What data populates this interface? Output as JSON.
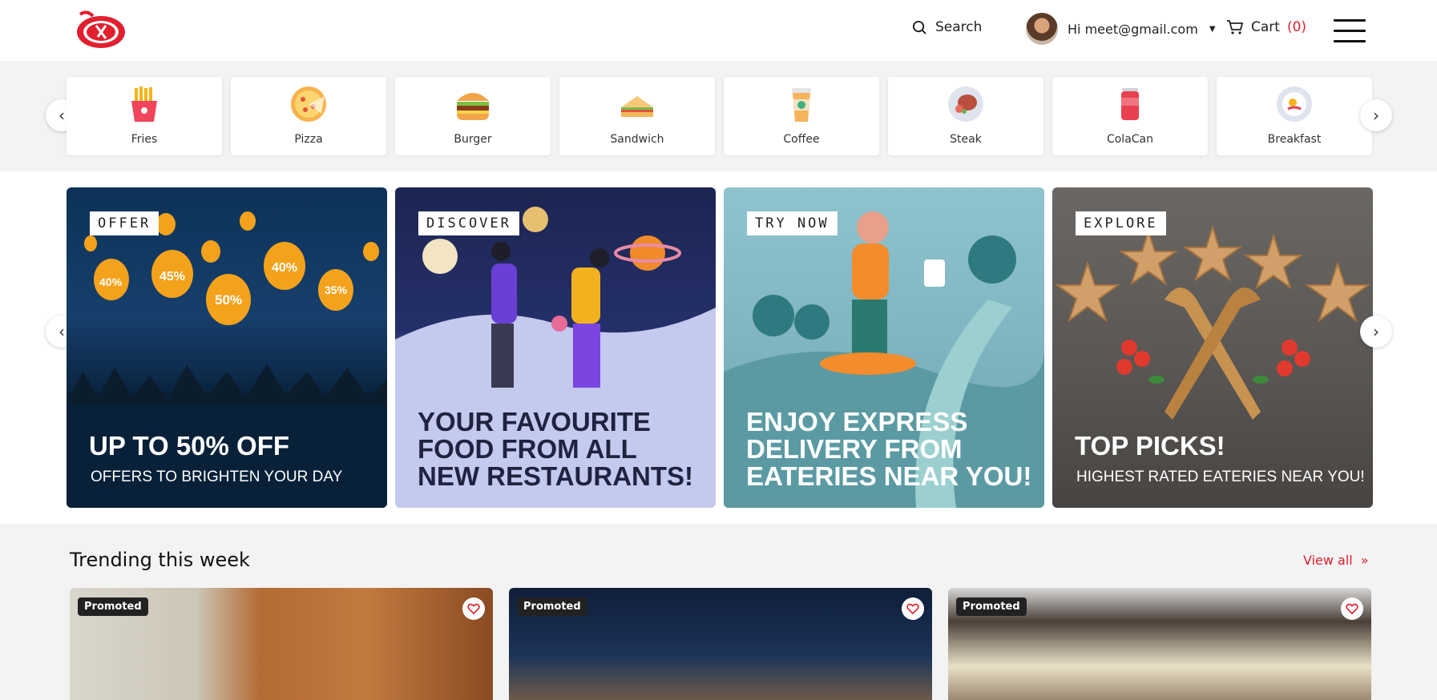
{
  "header": {
    "search_label": "Search",
    "user_greeting": "Hi meet@gmail.com",
    "cart_label": "Cart",
    "cart_count": "(0)"
  },
  "categories": [
    {
      "label": "Fries",
      "icon": "fries-icon"
    },
    {
      "label": "Pizza",
      "icon": "pizza-icon"
    },
    {
      "label": "Burger",
      "icon": "burger-icon"
    },
    {
      "label": "Sandwich",
      "icon": "sandwich-icon"
    },
    {
      "label": "Coffee",
      "icon": "coffee-icon"
    },
    {
      "label": "Steak",
      "icon": "steak-icon"
    },
    {
      "label": "ColaCan",
      "icon": "cola-can-icon"
    },
    {
      "label": "Breakfast",
      "icon": "breakfast-icon"
    }
  ],
  "banners": [
    {
      "tag": "OFFER",
      "headline": "UP TO 50% OFF",
      "sub": "OFFERS TO BRIGHTEN YOUR DAY",
      "lanterns": [
        "40%",
        "45%",
        "50%",
        "40%",
        "35%"
      ]
    },
    {
      "tag": "DISCOVER",
      "headline_lines": [
        "YOUR FAVOURITE",
        "FOOD FROM ALL",
        "NEW RESTAURANTS!"
      ]
    },
    {
      "tag": "TRY NOW",
      "headline_lines": [
        "ENJOY EXPRESS",
        "DELIVERY FROM",
        "EATERIES NEAR YOU!"
      ]
    },
    {
      "tag": "EXPLORE",
      "headline": "TOP PICKS!",
      "sub": "HIGHEST RATED EATERIES NEAR YOU!"
    }
  ],
  "trending": {
    "title": "Trending this week",
    "view_all": "View all",
    "cards": [
      {
        "badge": "Promoted"
      },
      {
        "badge": "Promoted"
      },
      {
        "badge": "Promoted"
      }
    ]
  },
  "colors": {
    "accent": "#e0202e",
    "dark": "#111111"
  }
}
